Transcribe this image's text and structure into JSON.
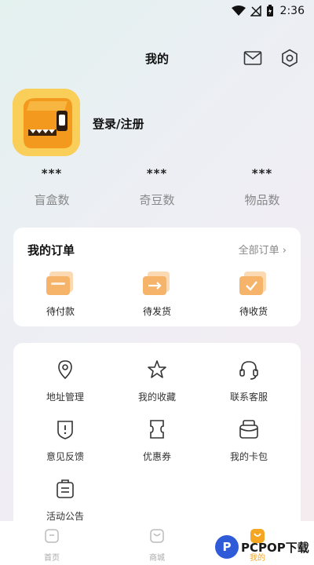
{
  "status_bar": {
    "time": "2:36"
  },
  "header": {
    "title": "我的"
  },
  "profile": {
    "login_label": "登录/注册"
  },
  "stats": [
    {
      "value": "***",
      "label": "盲盒数"
    },
    {
      "value": "***",
      "label": "奇豆数"
    },
    {
      "value": "***",
      "label": "物品数"
    }
  ],
  "orders": {
    "title": "我的订单",
    "all_label": "全部订单",
    "items": [
      {
        "label": "待付款",
        "icon": "wallet-icon"
      },
      {
        "label": "待发货",
        "icon": "shipping-icon"
      },
      {
        "label": "待收货",
        "icon": "receive-icon"
      }
    ]
  },
  "services": [
    {
      "label": "地址管理",
      "icon": "location-icon"
    },
    {
      "label": "我的收藏",
      "icon": "star-icon"
    },
    {
      "label": "联系客服",
      "icon": "headset-icon"
    },
    {
      "label": "意见反馈",
      "icon": "feedback-icon"
    },
    {
      "label": "优惠券",
      "icon": "coupon-icon"
    },
    {
      "label": "我的卡包",
      "icon": "card-wallet-icon"
    },
    {
      "label": "活动公告",
      "icon": "announcement-icon"
    }
  ],
  "tabbar": [
    {
      "label": "首页",
      "icon": "home-icon"
    },
    {
      "label": "商城",
      "icon": "shop-icon"
    },
    {
      "label": "我的",
      "icon": "profile-icon"
    }
  ],
  "watermark": {
    "text": "PCPOP下载"
  },
  "colors": {
    "accent": "#f5a623",
    "avatar": "#f7c44a",
    "order_icon": "#f6b36a"
  }
}
